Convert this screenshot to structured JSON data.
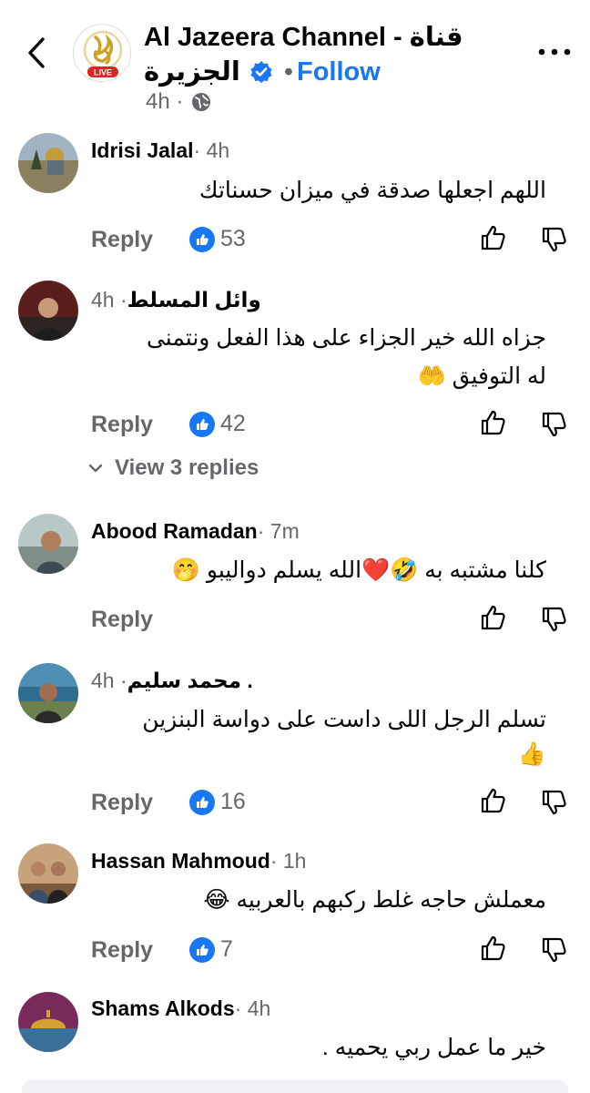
{
  "header": {
    "title_line1": "Al Jazeera Channel - قناة",
    "title_line2": "الجزيرة",
    "follow_label": "Follow",
    "dot": "•",
    "time": "4h ·",
    "logo_badge": "LIVE"
  },
  "colors": {
    "accent": "#1877f2",
    "secondary_text": "#65676b",
    "logo_gold": "#c9a227",
    "live_red": "#e02424"
  },
  "comments": [
    {
      "author": "Idrisi Jalal",
      "time": " · 4h",
      "text": "اللهم اجعلها صدقة في ميزان حسناتك",
      "reply": "Reply",
      "likes": "53"
    },
    {
      "author": "وائل  المسلط",
      "time": "4h · ",
      "text_line1": "جزاه الله خير الجزاء على هذا الفعل ونتمنى",
      "text_line2": "له التوفيق 🤲",
      "reply": "Reply",
      "likes": "42",
      "view_replies": "View 3 replies"
    },
    {
      "author": "Abood Ramadan",
      "time": " · 7m",
      "text": "كلنا مشتبه به 🤣❤️الله يسلم دواليبو 🤭",
      "reply": "Reply"
    },
    {
      "author": "محمد سليم .",
      "time": "4h · ",
      "text_line1": "تسلم الرجل اللى داست على دواسة البنزين",
      "text_line2": "👍",
      "reply": "Reply",
      "likes": "16"
    },
    {
      "author": "Hassan Mahmoud",
      "time": " · 1h",
      "text": "معملش حاجه غلط ركبهم بالعربيه 😂",
      "reply": "Reply",
      "likes": "7"
    },
    {
      "author": "Shams Alkods",
      "time": " · 4h",
      "text": "خير ما عمل ربي يحميه ."
    }
  ]
}
